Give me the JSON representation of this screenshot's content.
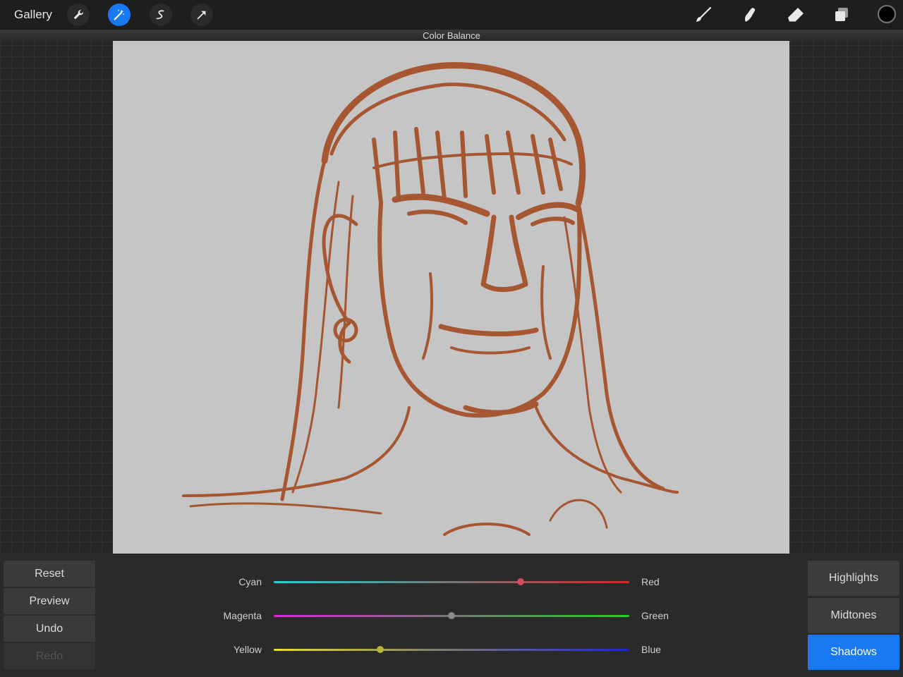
{
  "topbar": {
    "gallery_label": "Gallery",
    "tools_left": [
      {
        "name": "wrench-icon",
        "active": false
      },
      {
        "name": "magic-wand-icon",
        "active": true
      },
      {
        "name": "selection-icon",
        "active": false
      },
      {
        "name": "transform-arrow-icon",
        "active": false
      }
    ],
    "tools_right": [
      "brush-icon",
      "smudge-icon",
      "eraser-icon",
      "layers-icon"
    ],
    "current_color": "#000000"
  },
  "panel_title": "Color Balance",
  "canvas": {
    "background": "#c5c5c5",
    "stroke_color": "#a34a20"
  },
  "left_buttons": {
    "reset": "Reset",
    "preview": "Preview",
    "undo": "Undo",
    "redo": "Redo"
  },
  "sliders": [
    {
      "left": "Cyan",
      "right": "Red",
      "value": 0.695,
      "left_color": "#19d6d6",
      "right_color": "#e0202a",
      "knob_color": "#d44a5a"
    },
    {
      "left": "Magenta",
      "right": "Green",
      "value": 0.5,
      "left_color": "#e020e0",
      "right_color": "#20d020",
      "knob_color": "#8a8a8a"
    },
    {
      "left": "Yellow",
      "right": "Blue",
      "value": 0.3,
      "left_color": "#e8e020",
      "right_color": "#2020e0",
      "knob_color": "#b6b43a"
    }
  ],
  "range_buttons": {
    "highlights": "Highlights",
    "midtones": "Midtones",
    "shadows": "Shadows",
    "selected": "Shadows"
  }
}
